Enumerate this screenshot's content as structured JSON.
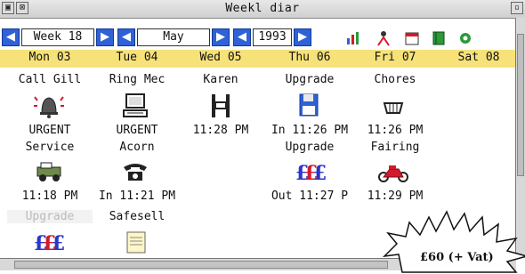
{
  "window": {
    "title": "Weekl  diar"
  },
  "toolbar": {
    "week_value": "Week 18",
    "month_value": "May",
    "year_value": "1993",
    "prev_arrow": "◀",
    "next_arrow": "▶"
  },
  "days": [
    "Mon 03",
    "Tue 04",
    "Wed 05",
    "Thu 06",
    "Fri 07",
    "Sat 08"
  ],
  "entries": {
    "row1": [
      "Call Gill",
      "Ring Mec",
      "Karen",
      "Upgrade",
      "Chores"
    ],
    "mon": {
      "line1": "URGENT",
      "line2": "Service",
      "time": "11:18 PM",
      "extra": "Upgrade"
    },
    "tue": {
      "line1": "URGENT",
      "line2": "Acorn",
      "time": "In 11:21 PM",
      "extra": "Safesell"
    },
    "wed": {
      "time": "11:28 PM"
    },
    "thu": {
      "time": "In 11:26 PM",
      "line2": "Upgrade",
      "time2": "Out 11:27 P"
    },
    "fri": {
      "time": "11:26 PM",
      "line2": "Fairing",
      "time2": "11:29 PM"
    }
  },
  "price_tag": "£60 (+ Vat)",
  "icons": {
    "bell": "alarm-bell-icon",
    "computer": "computer-icon",
    "film": "film-icon",
    "disk": "floppy-disk-icon",
    "basket": "basket-icon",
    "car": "jeep-icon",
    "phone": "telephone-icon",
    "money1": "money-icon",
    "money2": "money-icon",
    "bike": "motorbike-icon",
    "memo": "memo-icon"
  },
  "colors": {
    "accent_blue": "#2f62d6",
    "day_header_bg": "#f7e27a",
    "money_blue": "#2a36c8",
    "money_red": "#d21a2c"
  }
}
